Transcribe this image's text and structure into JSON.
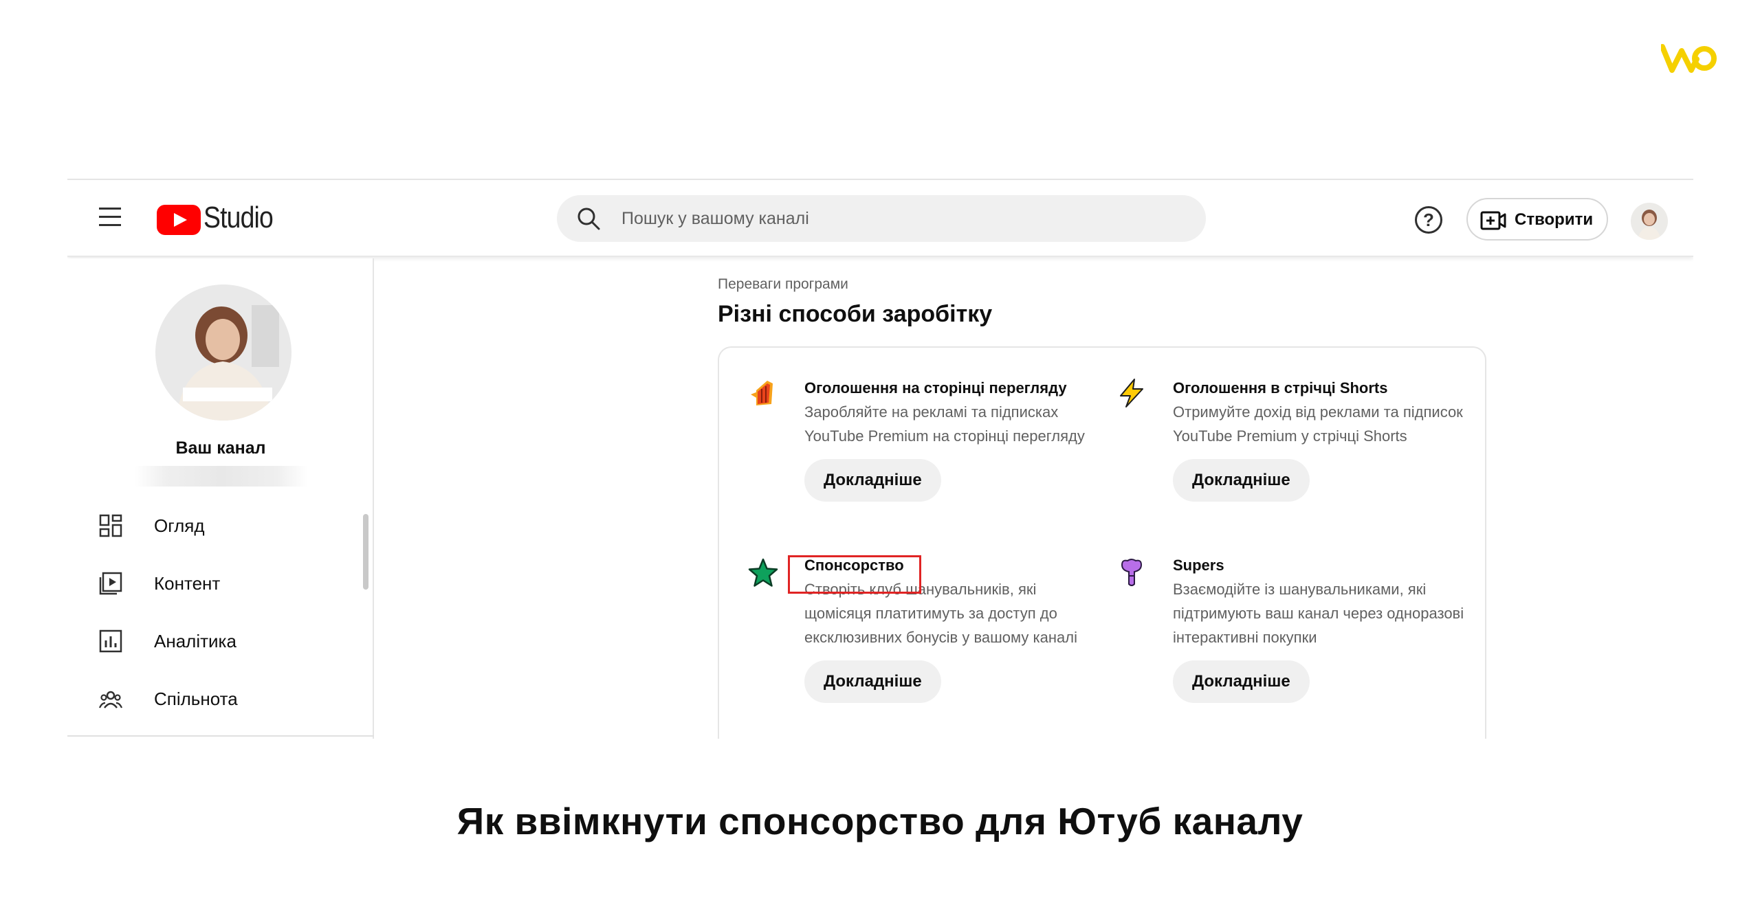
{
  "brand_logo": {
    "icon": "wo-logo-icon",
    "color": "#f5d000"
  },
  "app": {
    "logo_text": "Studio",
    "logo_color": "#ff0000",
    "menu_icon": "hamburger-icon"
  },
  "search": {
    "placeholder": "Пошук у вашому каналі",
    "value": ""
  },
  "header": {
    "help_icon": "help-icon",
    "help_glyph": "?",
    "create_label": "Створити",
    "create_icon": "video-add-icon"
  },
  "sidebar": {
    "channel_name": "Ваш канал",
    "items": [
      {
        "label": "Огляд",
        "icon": "dashboard-icon"
      },
      {
        "label": "Контент",
        "icon": "content-icon"
      },
      {
        "label": "Аналітика",
        "icon": "analytics-icon"
      },
      {
        "label": "Спільнота",
        "icon": "community-icon"
      }
    ]
  },
  "main": {
    "kicker": "Переваги програми",
    "title": "Різні способи заробітку",
    "features": [
      {
        "title": "Оголошення на сторінці перегляду",
        "desc": "Заробляйте на рекламі та підписках YouTube Premium на сторінці перегляду",
        "button": "Докладніше",
        "icon": "watch-page-ads-icon"
      },
      {
        "title": "Оголошення в стрічці Shorts",
        "desc": "Отримуйте дохід від реклами та підписок YouTube Premium у стрічці Shorts",
        "button": "Докладніше",
        "icon": "shorts-ads-icon"
      },
      {
        "title": "Спонсорство",
        "desc": "Створіть клуб шанувальників, які щомісяця платитимуть за доступ до ексклюзивних бонусів у вашому каналі",
        "button": "Докладніше",
        "icon": "star-icon"
      },
      {
        "title": "Supers",
        "desc": "Взаємодійте із шанувальниками, які підтримують ваш канал через одноразові інтерактивні покупки",
        "button": "Докладніше",
        "icon": "supers-icon"
      }
    ]
  },
  "caption": "Як ввімкнути спонсорство для Ютуб каналу"
}
